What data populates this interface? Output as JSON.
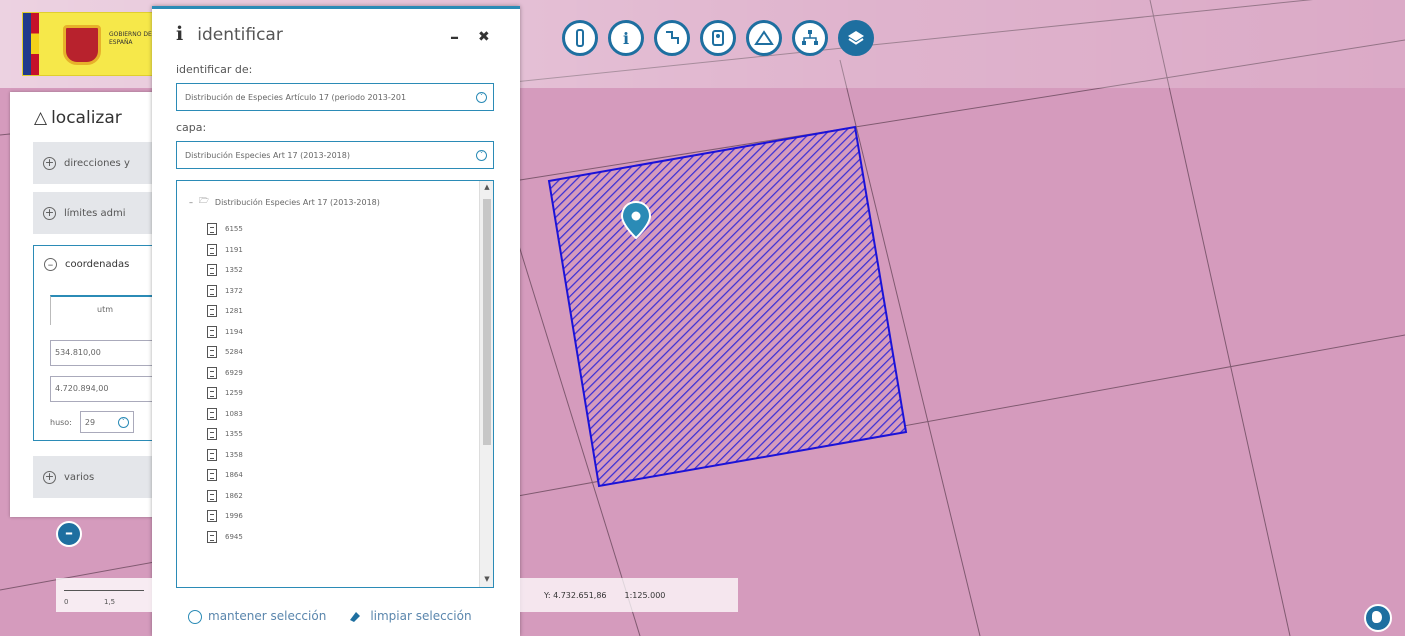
{
  "logo": {
    "text": "GOBIERNO DE ESPAÑA"
  },
  "toolbar": {
    "buttons": [
      "ruler-icon",
      "info-icon",
      "measure-icon",
      "bookmark-icon",
      "profile-icon",
      "network-icon",
      "layers-icon"
    ]
  },
  "localizar": {
    "title": "localizar",
    "sections": [
      "direcciones y",
      "límites admi",
      "coordenadas",
      "varios"
    ],
    "tab_utm": "utm",
    "x_value": "534.810,00",
    "y_value": "4.720.894,00",
    "huso_label": "huso:",
    "huso_value": "29"
  },
  "identificar": {
    "title": "identificar",
    "identificar_de_label": "identificar de:",
    "identificar_de_value": "Distribución de Especies Artículo 17 (periodo 2013-201",
    "capa_label": "capa:",
    "capa_value": "Distribución Especies Art 17 (2013-2018)",
    "tree_root": "Distribución Especies Art 17 (2013-2018)",
    "tree_items": [
      "6155",
      "1191",
      "1352",
      "1372",
      "1281",
      "1194",
      "5284",
      "6929",
      "1259",
      "1083",
      "1355",
      "1358",
      "1864",
      "1862",
      "1996",
      "6945"
    ],
    "keep_selection": "mantener selección",
    "clear_selection": "limpiar selección"
  },
  "scale": {
    "labels": [
      "0",
      "1,5"
    ]
  },
  "status": {
    "y_coord": "Y: 4.732.651,86",
    "scale": "1:125.000"
  },
  "colors": {
    "accent": "#1e6fa0",
    "map_bg": "#d59bbd",
    "feature": "#3a2fd6"
  }
}
